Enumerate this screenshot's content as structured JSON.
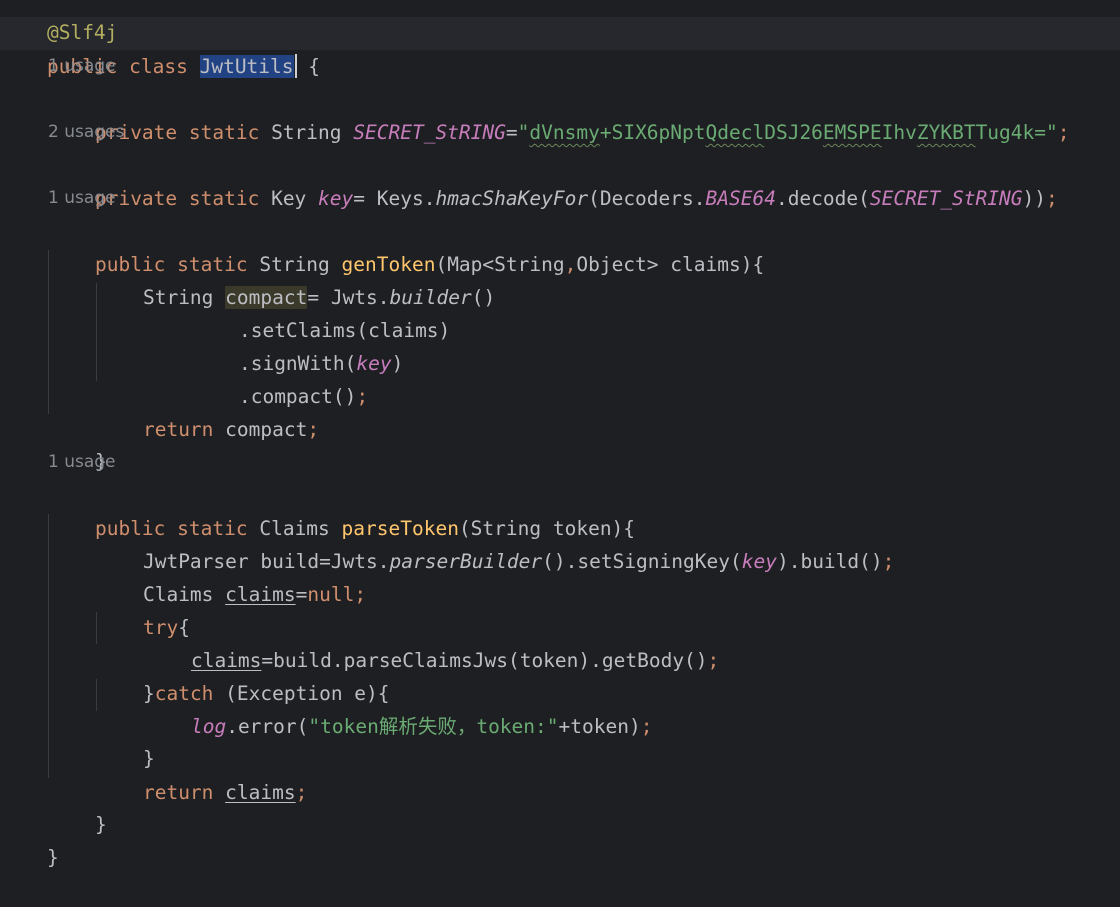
{
  "editor": {
    "annotation": "@Slf4j",
    "class_decl": {
      "modifiers": "public class ",
      "name": "JwtUtils",
      "brace": " {"
    },
    "hints": {
      "h1": "1 usage",
      "h2": "2 usages",
      "h3": "1 usage",
      "h4": "1 usage"
    },
    "field1": {
      "mods": "private static ",
      "type": "String ",
      "name": "SECRET_StRING",
      "eq": "=",
      "q1": "\"",
      "w1": "dVnsmy",
      "s1": "+SIX6pNpt",
      "w2": "Qdecl",
      "s2": "DSJ26",
      "w3": "EMSPE",
      "s3": "Ihv",
      "w4": "ZYKBT",
      "s4": "Tug4k=",
      "q2": "\"",
      "semi": ";"
    },
    "field2": {
      "mods": "private static ",
      "type": "Key ",
      "name": "key",
      "eq": "= Keys.",
      "m1": "hmacShaKeyFor",
      "p1": "(Decoders.",
      "const": "BASE64",
      "p2": ".decode(",
      "arg": "SECRET_StRING",
      "p3": "))",
      "semi": ";"
    },
    "gen": {
      "mods": "public static ",
      "type": "String ",
      "name": "genToken",
      "p1": "(Map<String",
      "comma": ",",
      "p2": "Object> claims){",
      "l1_type": "String ",
      "l1_var": "compact",
      "l1_eq": "= Jwts.",
      "l1_m": "builder",
      "l1_p": "()",
      "l2": ".setClaims(claims)",
      "l3_a": ".signWith(",
      "l3_f": "key",
      "l3_b": ")",
      "l4_a": ".compact()",
      "l4_semi": ";",
      "ret_kw": "return ",
      "ret_v": "compact",
      "ret_semi": ";",
      "close": "}"
    },
    "parse": {
      "mods": "public static ",
      "type": "Claims ",
      "name": "parseToken",
      "params": "(String token){",
      "b1_a": "JwtParser build=Jwts.",
      "b1_m": "parserBuilder",
      "b1_b": "().setSigningKey(",
      "b1_f": "key",
      "b1_c": ").build()",
      "b1_semi": ";",
      "c1_a": "Claims ",
      "c1_v": "claims",
      "c1_eq": "=",
      "c1_null": "null",
      "c1_semi": ";",
      "try_kw": "try",
      "try_b": "{",
      "t1_v": "claims",
      "t1_rest": "=build.parseClaimsJws(token).getBody()",
      "t1_semi": ";",
      "catch_a": "}",
      "catch_kw": "catch",
      "catch_b": " (Exception e){",
      "log_v": "log",
      "log_a": ".error(",
      "log_s": "\"token解析失败，token:\"",
      "log_b": "+token)",
      "log_semi": ";",
      "close_inner": "}",
      "ret_kw": "return ",
      "ret_v": "claims",
      "ret_semi": ";",
      "close": "}"
    },
    "class_close": "}"
  }
}
